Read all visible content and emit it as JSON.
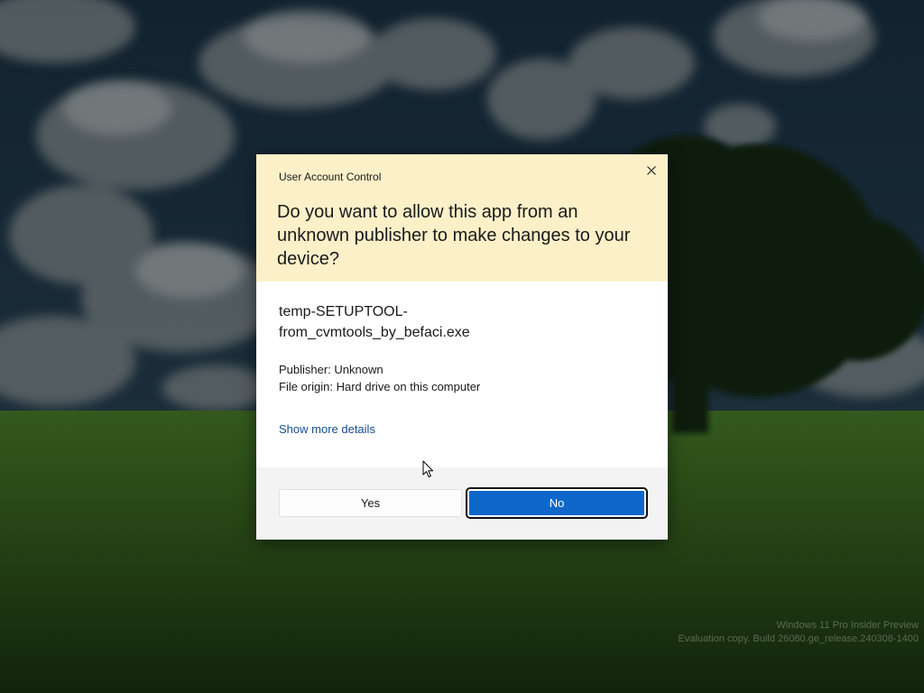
{
  "dialog": {
    "title": "User Account Control",
    "question": "Do you want to allow this app from an unknown publisher to make changes to your device?",
    "app_name_line1": "temp-SETUPTOOL-",
    "app_name_line2": "from_cvmtools_by_befaci.exe",
    "publisher": "Publisher: Unknown",
    "file_origin": "File origin: Hard drive on this computer",
    "show_more_details": "Show more details",
    "yes_label": "Yes",
    "no_label": "No",
    "close_icon": "close-icon"
  },
  "watermark": {
    "line1": "Windows 11 Pro Insider Preview",
    "line2": "Evaluation copy. Build 26080.ge_release.240308-1400"
  },
  "colors": {
    "header_background": "#fcf0c9",
    "primary_button": "#0f67c9",
    "link": "#1a4c8a",
    "footer_background": "#f3f3f3"
  }
}
